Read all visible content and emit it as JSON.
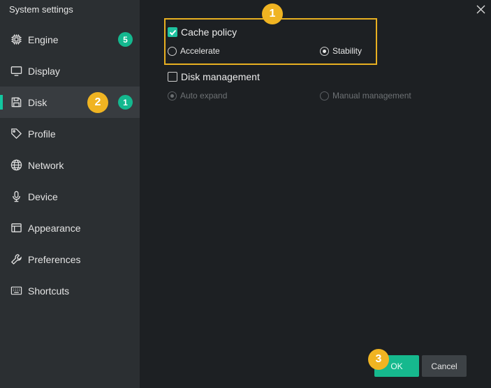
{
  "window": {
    "title": "System settings"
  },
  "sidebar": {
    "items": [
      {
        "label": "Engine",
        "icon": "chip-icon",
        "badge": "5"
      },
      {
        "label": "Display",
        "icon": "monitor-icon"
      },
      {
        "label": "Disk",
        "icon": "floppy-disk-icon",
        "badge": "1",
        "active": true
      },
      {
        "label": "Profile",
        "icon": "tag-icon"
      },
      {
        "label": "Network",
        "icon": "globe-icon"
      },
      {
        "label": "Device",
        "icon": "microphone-icon"
      },
      {
        "label": "Appearance",
        "icon": "window-layout-icon"
      },
      {
        "label": "Preferences",
        "icon": "wrench-icon"
      },
      {
        "label": "Shortcuts",
        "icon": "keyboard-icon"
      }
    ]
  },
  "steps": {
    "one": "1",
    "two": "2",
    "three": "3"
  },
  "cache_policy": {
    "label": "Cache policy",
    "checked": true,
    "options": {
      "accelerate": "Accelerate",
      "stability": "Stability"
    },
    "selected": "Stability"
  },
  "disk_management": {
    "label": "Disk management",
    "checked": false,
    "options": {
      "auto_expand": "Auto expand",
      "manual": "Manual management"
    },
    "selected": "Auto expand"
  },
  "buttons": {
    "ok": "OK",
    "cancel": "Cancel"
  },
  "colors": {
    "accent": "#14b88f",
    "step_badge": "#f0b422",
    "highlight_border": "#e8b021",
    "sidebar_bg": "#2b2f32",
    "content_bg": "#1d2023"
  }
}
